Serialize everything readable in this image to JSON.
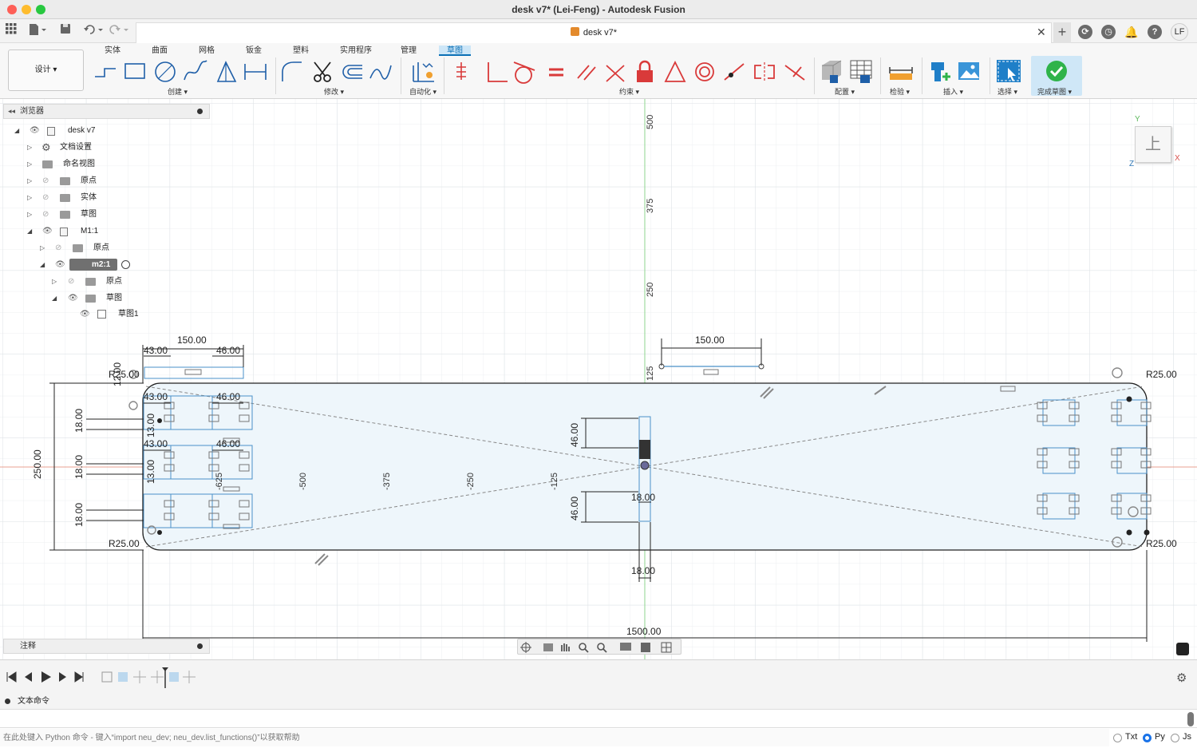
{
  "window": {
    "title": "desk v7* (Lei-Feng) - Autodesk Fusion"
  },
  "doc_tab": {
    "title": "desk v7*",
    "user_initials": "LF"
  },
  "ribbon": {
    "tabs": [
      "实体",
      "曲面",
      "网格",
      "钣金",
      "塑料",
      "实用程序",
      "管理",
      "草图"
    ],
    "active_tab": "草图",
    "workspace": "设计 ▾",
    "groups": {
      "create": "创建 ▾",
      "modify": "修改 ▾",
      "automate": "自动化 ▾",
      "constraints": "约束 ▾",
      "configure": "配置 ▾",
      "inspect": "检验 ▾",
      "insert": "插入 ▾",
      "select": "选择 ▾",
      "finish": "完成草图 ▾"
    }
  },
  "browser": {
    "title": "浏览器",
    "items": [
      {
        "label": "desk v7"
      },
      {
        "label": "文档设置"
      },
      {
        "label": "命名视图"
      },
      {
        "label": "原点"
      },
      {
        "label": "实体"
      },
      {
        "label": "草图"
      },
      {
        "label": "M1:1"
      },
      {
        "label": "原点"
      },
      {
        "label": "m2:1"
      },
      {
        "label": "原点"
      },
      {
        "label": "草图"
      },
      {
        "label": "草图1"
      }
    ]
  },
  "notes": {
    "title": "注释"
  },
  "sketch": {
    "dims": {
      "overall_width": "1500.00",
      "overall_height": "250.00",
      "top_width": "150.00",
      "center_width": "150.00",
      "d43": "43.00",
      "d46": "46.00",
      "d18": "18.00",
      "d13": "13.00",
      "d12": "12.00",
      "radius": "R25.00"
    },
    "ruler_v": [
      "500",
      "375",
      "250",
      "125"
    ],
    "ruler_h": [
      "-500",
      "-375",
      "-250",
      "-125",
      "-625"
    ]
  },
  "viewcube": {
    "face": "上",
    "x": "X",
    "y": "Y",
    "z": "Z"
  },
  "command": {
    "header": "文本命令",
    "placeholder": "在此处键入 Python 命令 - 键入“import neu_dev; neu_dev.list_functions()”以获取帮助",
    "options": [
      "Txt",
      "Py",
      "Js"
    ],
    "selected": "Py"
  },
  "colors": {
    "accent": "#0a6fb5",
    "sketch_fill": "#eef6fb",
    "finish_green": "#2fb34a",
    "red_tool": "#d93a3a"
  }
}
